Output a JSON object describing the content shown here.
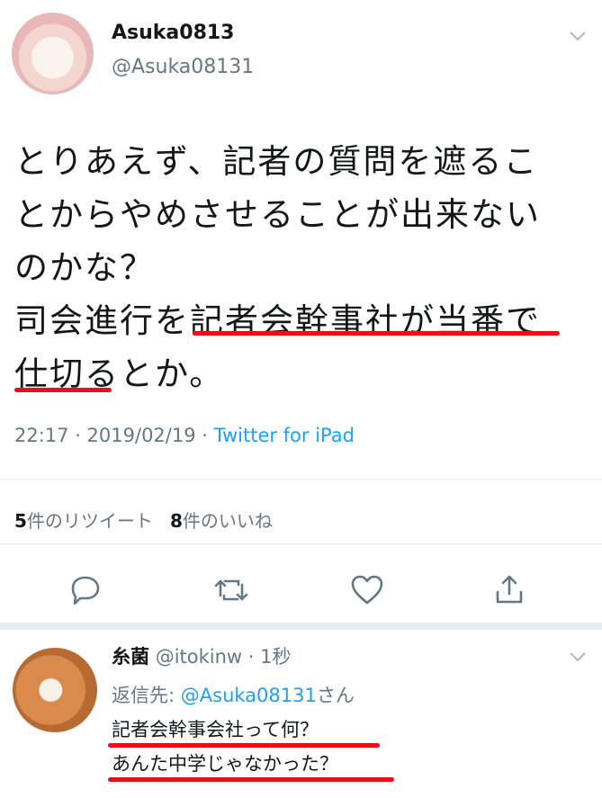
{
  "tweet": {
    "display_name": "Asuka0813",
    "handle": "@Asuka08131",
    "text": "とりあえず、記者の質問を遮るこ\nとからやめさせることが出来ない\nのかな？\n司会進行を記者会幹事社が当番で\n仕切るとか。",
    "timestamp": "22:17 · 2019/02/19 · ",
    "client": "Twitter for iPad",
    "retweet_count": "5",
    "retweet_label": "件のリツイート",
    "like_count": "8",
    "like_label": "件のいいね"
  },
  "actions": {
    "reply_icon": "comment-icon",
    "retweet_icon": "retweet-icon",
    "like_icon": "heart-icon",
    "share_icon": "share-icon"
  },
  "reply": {
    "display_name": "糸菌",
    "handle_time": "@itokinw · 1秒",
    "replying_to_label": "返信先: ",
    "replying_to_handle": "@Asuka08131",
    "replying_to_suffix": "さん",
    "text": "記者会幹事会社って何？\nあんた中学じゃなかった？"
  },
  "colors": {
    "accent": "#1da1f2",
    "underline": "#e8111b",
    "secondary_text": "#657786"
  }
}
